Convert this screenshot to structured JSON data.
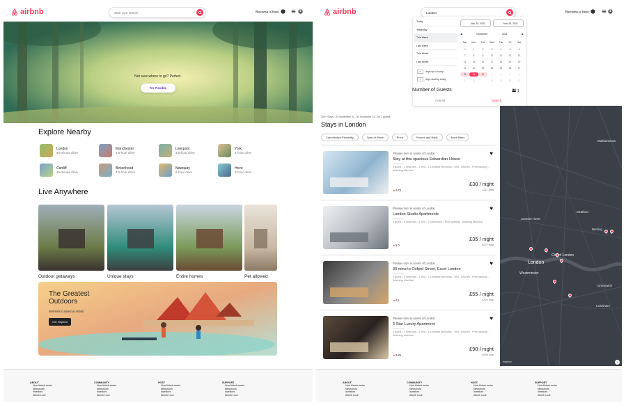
{
  "left_page": {
    "header": {
      "brand": "airbnb",
      "search_placeholder": "Start your search",
      "host_link": "Become a host"
    },
    "hero": {
      "question": "Not sure where to go? Perfect.",
      "button": "I'm Flexible"
    },
    "explore": {
      "title": "Explore Nearby",
      "items": [
        {
          "city": "London",
          "distance": "45-minute drive"
        },
        {
          "city": "Manchester",
          "distance": "4.5-hour drive"
        },
        {
          "city": "Liverpool",
          "distance": "4.5-hour drive"
        },
        {
          "city": "York",
          "distance": "4-hour drive"
        },
        {
          "city": "Cardiff",
          "distance": "45-minute drive"
        },
        {
          "city": "Birkenhead",
          "distance": "4.5-hour drive"
        },
        {
          "city": "Newquay",
          "distance": "6-hour drive"
        },
        {
          "city": "Hove",
          "distance": "2-hour drive"
        }
      ]
    },
    "live": {
      "title": "Live Anywhere",
      "cards": [
        {
          "label": "Outdoor getaways"
        },
        {
          "label": "Unique stays"
        },
        {
          "label": "Entire homes"
        },
        {
          "label": "Pet allowed"
        }
      ]
    },
    "banner": {
      "title_line1": "The Greatest",
      "title_line2": "Outdoors",
      "subtitle": "Wishlists curated at Airbnb",
      "button": "Get Inspired"
    },
    "footer": {
      "columns": [
        {
          "title": "ABOUT",
          "links": [
            "How Airbnb works",
            "Newsroom",
            "Investors",
            "Airbnb Luxe"
          ]
        },
        {
          "title": "COMMUNITY",
          "links": [
            "How Airbnb works",
            "Newsroom",
            "Investors",
            "Airbnb Luxe"
          ]
        },
        {
          "title": "HOST",
          "links": [
            "How Airbnb works",
            "Newsroom",
            "Investors",
            "Airbnb Luxe"
          ]
        },
        {
          "title": "SUPPORT",
          "links": [
            "How Airbnb works",
            "Newsroom",
            "Investors",
            "Airbnb Luxe"
          ]
        }
      ]
    }
  },
  "right_page": {
    "header": {
      "brand": "airbnb",
      "search_value": "London",
      "host_link": "Become a host"
    },
    "datepicker": {
      "start": "Nov 20, 2021",
      "end": "Nov 20, 2021",
      "presets": [
        "Today",
        "Yesterday",
        "This Week",
        "Last Week",
        "This Month",
        "Last Month"
      ],
      "selected_preset": "This Week",
      "up_to_today_value": "0",
      "up_to_today_label": "days up to today",
      "starting_today_value": "7",
      "starting_today_label": "days starting today",
      "month": "November",
      "year": "2021",
      "weekdays": [
        "Sun",
        "Mon",
        "Tue",
        "Wed",
        "Thu",
        "Fri",
        "Sat"
      ],
      "days": [
        "31",
        "1",
        "2",
        "3",
        "4",
        "5",
        "6",
        "7",
        "8",
        "9",
        "10",
        "11",
        "12",
        "13",
        "14",
        "15",
        "16",
        "17",
        "18",
        "19",
        "20",
        "21",
        "22",
        "23",
        "24",
        "25",
        "26",
        "27",
        "28",
        "29",
        "30",
        "1",
        "2",
        "3",
        "4",
        "5",
        "6",
        "7",
        "8",
        "9",
        "10",
        "11"
      ],
      "guests_label": "Number of Guests",
      "guests_value": "1",
      "cancel": "Cancel",
      "search": "Search"
    },
    "results": {
      "summary": "300+ Stays - 29 November 21 - 30 November 21 - for 1 guests",
      "title": "Stays in London",
      "filters": [
        "Cancellation Flexibility",
        "Type of Place",
        "Price",
        "Rooms and Beds",
        "More filters"
      ],
      "listings": [
        {
          "subtitle": "Private room in center of London",
          "name": "Stay at this spacious Edwardian House",
          "amenities": "1 guest - 1 bedroom - 1 bed - 1.5 shared bthrooms - Wifi - Kitchen - Free parking - Washing Machine",
          "price": "£30 / night",
          "total": "£117 total",
          "rating": "4.73"
        },
        {
          "subtitle": "Private room in center of London",
          "name": "London Studio Apartments",
          "amenities": "4 guest - 4 bedroom - 4 bed - 2 bathrooms - Free parking - Washing Machine",
          "price": "£35 / night",
          "total": "£207 total",
          "rating": "5.0"
        },
        {
          "subtitle": "Private room in center of London",
          "name": "30 mins to Oxford Street, Excel London",
          "amenities": "1 guest - 1 bedroom - 1 bed - 1.5 shared bthrooms - Wifi - Kitchen - Free parking - Washing Machine",
          "price": "£55 / night",
          "total": "£320 total",
          "rating": "4.1"
        },
        {
          "subtitle": "Private room in center of London",
          "name": "5 Star Luxury Apartment",
          "amenities": "3 guest - 1 bedroom - 1 bed - 1.5 shared bthrooms - Wifi - Kitchen - Free parking - Washing Machine",
          "price": "£90 / night",
          "total": "£650 total",
          "rating": "3.85"
        }
      ]
    },
    "map": {
      "city_label": "London",
      "area_labels": [
        "City of London",
        "Westminster",
        "Greenwich",
        "Lewisham",
        "Walthamstow",
        "Barking",
        "Camden Town",
        "Stratford"
      ],
      "attribution": "mapbox"
    },
    "footer": {
      "columns": [
        {
          "title": "ABOUT",
          "links": [
            "How Airbnb works",
            "Newsroom",
            "Investors",
            "Airbnb Luxe"
          ]
        },
        {
          "title": "COMMUNITY",
          "links": [
            "How Airbnb works",
            "Newsroom",
            "Investors",
            "Airbnb Luxe"
          ]
        },
        {
          "title": "HOST",
          "links": [
            "How Airbnb works",
            "Newsroom",
            "Investors",
            "Airbnb Luxe"
          ]
        },
        {
          "title": "SUPPORT",
          "links": [
            "How Airbnb works",
            "Newsroom",
            "Investors",
            "Airbnb Luxe"
          ]
        }
      ]
    }
  }
}
